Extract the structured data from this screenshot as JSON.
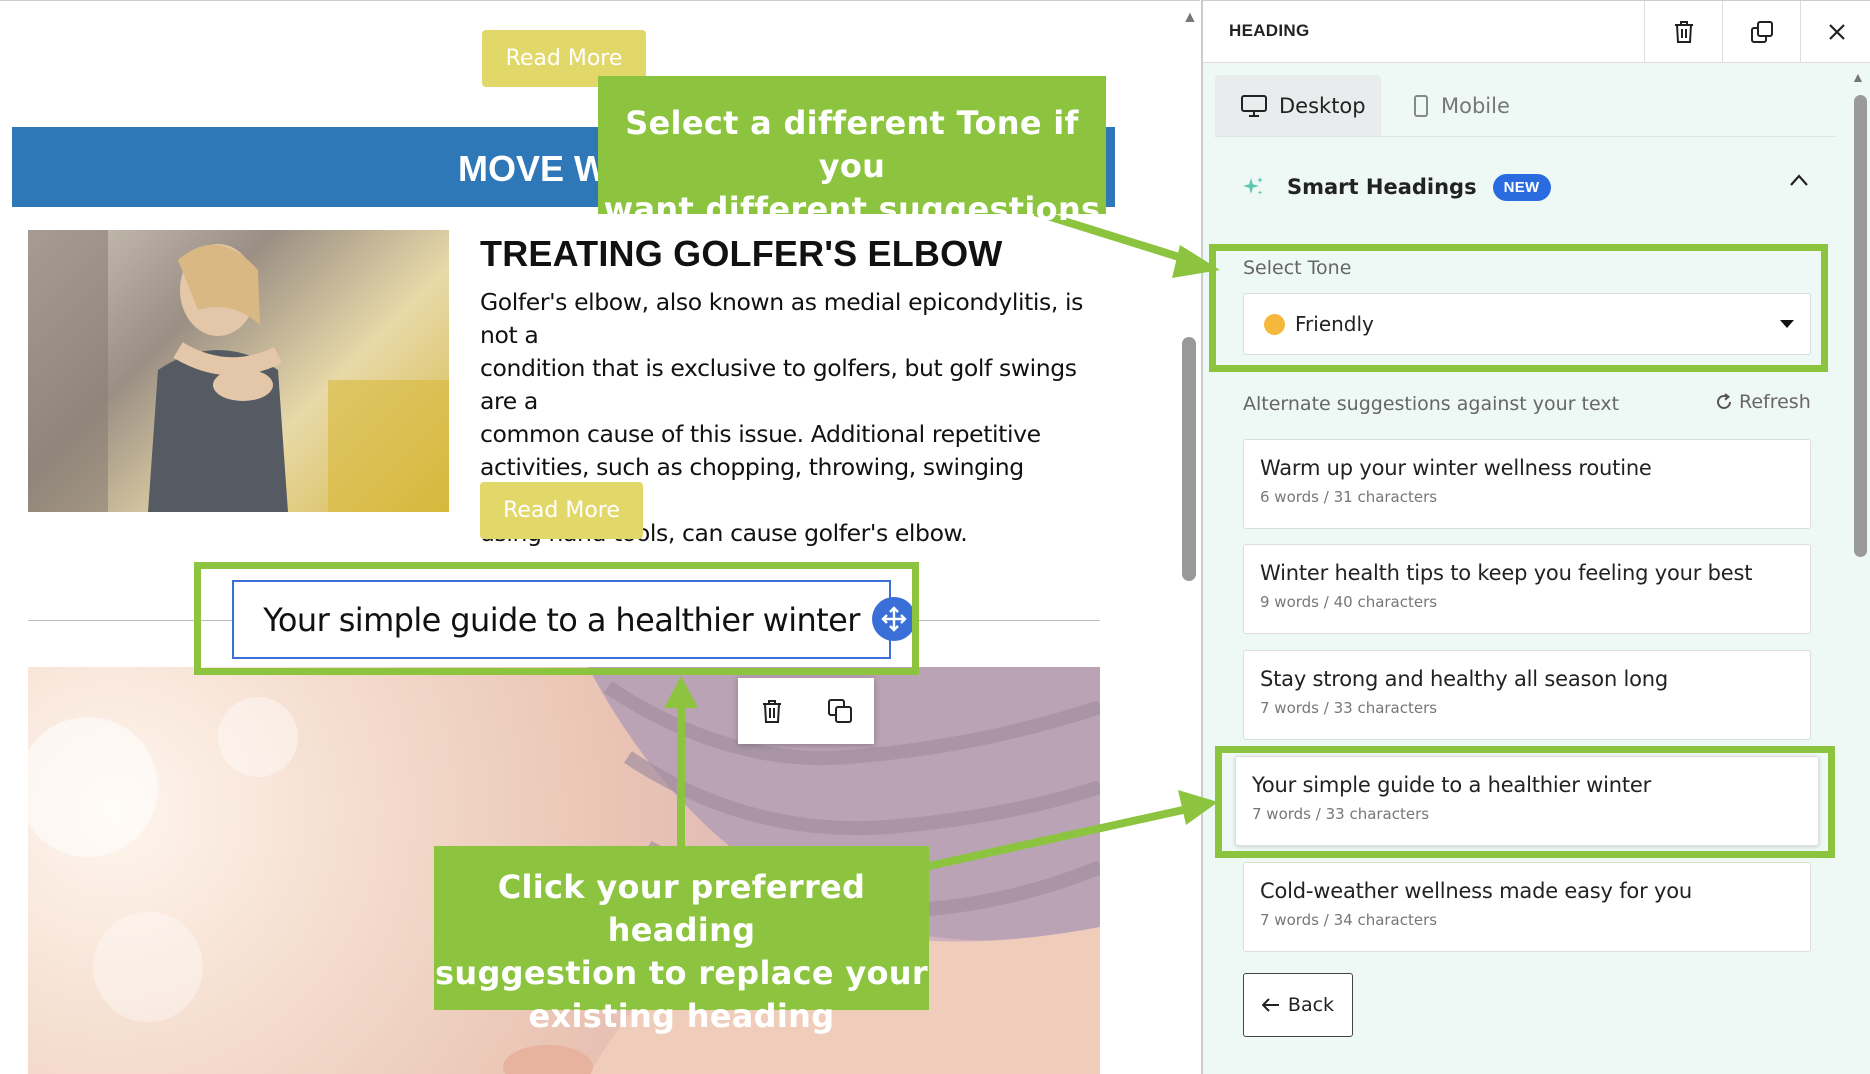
{
  "canvas": {
    "read_more_top": "Read More",
    "banner_text": "MOVE W",
    "article": {
      "title": "TREATING GOLFER'S ELBOW",
      "body_lines": [
        "Golfer's elbow, also known as medial epicondylitis, is not a",
        "condition that is exclusive to golfers, but golf swings are a",
        "common cause of this issue. Additional repetitive",
        "activities, such as chopping, throwing, swinging objects, or",
        "using hand tools, can cause golfer's elbow."
      ],
      "read_more": "Read More"
    },
    "heading": "Your simple guide to a healthier winter"
  },
  "annotations": {
    "tone_callout": [
      "Select a different Tone if you",
      "want different suggestions"
    ],
    "click_callout": [
      "Click your preferred heading",
      "suggestion to replace your",
      "existing heading"
    ],
    "color": "#8cc43f"
  },
  "panel": {
    "title": "HEADING",
    "tabs": [
      {
        "label": "Desktop",
        "active": true
      },
      {
        "label": "Mobile",
        "active": false
      }
    ],
    "smart_headings": {
      "title": "Smart Headings",
      "badge": "NEW"
    },
    "tone": {
      "label": "Select Tone",
      "value": "Friendly"
    },
    "alternate_label": "Alternate suggestions against your text",
    "refresh_label": "Refresh",
    "suggestions": [
      {
        "title": "Warm up your winter wellness routine",
        "meta": "6 words / 31 characters"
      },
      {
        "title": "Winter health tips to keep you feeling your best",
        "meta": "9 words / 40 characters"
      },
      {
        "title": "Stay strong and healthy all season long",
        "meta": "7 words / 33 characters"
      },
      {
        "title": "Your simple guide to a healthier winter",
        "meta": "7 words / 33 characters"
      },
      {
        "title": "Cold-weather wellness made easy for you",
        "meta": "7 words / 34 characters"
      }
    ],
    "back_label": "Back"
  },
  "colors": {
    "accent_blue": "#2b6be0",
    "banner_blue": "#2e78b8",
    "button_yellow": "#e2d769",
    "panel_bg": "#eef8f5"
  }
}
